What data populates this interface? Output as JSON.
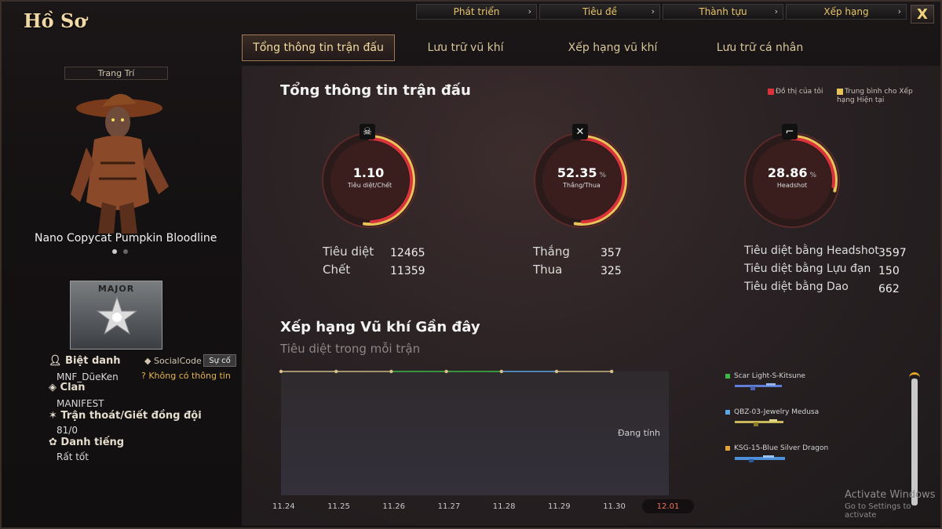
{
  "window": {
    "title": "Hồ Sơ",
    "close_label": "X"
  },
  "top_menu": [
    {
      "label": "Phát triển"
    },
    {
      "label": "Tiêu đề"
    },
    {
      "label": "Thành tựu"
    },
    {
      "label": "Xếp hạng"
    }
  ],
  "tabs": [
    {
      "label": "Tổng thông tin trận đấu",
      "active": true
    },
    {
      "label": "Lưu trữ vũ khí"
    },
    {
      "label": "Xếp hạng vũ khí"
    },
    {
      "label": "Lưu trữ cá nhân"
    }
  ],
  "left": {
    "decoration_label": "Trang Trí",
    "character_name": "Nano Copycat Pumpkin Bloodline",
    "rank": "MAJOR",
    "nickname_label": "Biệt danh",
    "nickname_value": "MNF_DũeKen",
    "social_code_label": "SocialCode",
    "social_code_button": "Sự cố",
    "social_code_info": "Không có thông tin",
    "clan_label": "Clan",
    "clan_value": "MANIFEST",
    "desert_label": "Trận thoát/Giết đồng đội",
    "desert_value": "81/0",
    "reputation_label": "Danh tiếng",
    "reputation_value": "Rất tốt"
  },
  "overview": {
    "title": "Tổng thông tin trận đấu",
    "legend_mine": "Đồ thị của tôi",
    "legend_avg": "Trung bình cho Xếp hạng Hiện tại",
    "colors": {
      "mine": "#d8333a",
      "avg": "#e7c35a"
    },
    "gauges": [
      {
        "value": "1.10",
        "unit": "",
        "label": "Tiêu diệt/Chết",
        "icon": "skull-icon",
        "fill": 0.52
      },
      {
        "value": "52.35",
        "unit": "%",
        "label": "Thắng/Thua",
        "icon": "crossed-rifles-icon",
        "fill": 0.5235
      },
      {
        "value": "28.86",
        "unit": "%",
        "label": "Headshot",
        "icon": "rifle-icon",
        "fill": 0.2886
      }
    ],
    "stats_kd": [
      {
        "label": "Tiêu diệt",
        "value": "12465"
      },
      {
        "label": "Chết",
        "value": "11359"
      }
    ],
    "stats_wl": [
      {
        "label": "Thắng",
        "value": "357"
      },
      {
        "label": "Thua",
        "value": "325"
      }
    ],
    "stats_hs": [
      {
        "label": "Tiêu diệt bằng Headshot",
        "value": "3597"
      },
      {
        "label": "Tiêu diệt bằng Lựu đạn",
        "value": "150"
      },
      {
        "label": "Tiêu diệt bằng Dao",
        "value": "662"
      }
    ]
  },
  "weapons": {
    "title": "Xếp hạng Vũ khí Gần đây",
    "subtitle": "Tiêu diệt trong mỗi trận",
    "pending": "Đang tính",
    "selected_date": "12.01",
    "list": [
      {
        "name": "Scar Light-S-Kitsune",
        "color": "#3fb84a"
      },
      {
        "name": "QBZ-03-Jewelry Medusa",
        "color": "#5aa7e6"
      },
      {
        "name": "KSG-15-Blue Silver Dragon",
        "color": "#e0a23a"
      }
    ]
  },
  "chart_data": {
    "type": "line",
    "title": "Xếp hạng Vũ khí Gần đây",
    "subtitle": "Tiêu diệt trong mỗi trận",
    "x": [
      "11.24",
      "11.25",
      "11.26",
      "11.27",
      "11.28",
      "11.29",
      "11.30",
      "12.01"
    ],
    "series": [
      {
        "name": "Scar Light-S-Kitsune",
        "color": "#3fb84a"
      },
      {
        "name": "QBZ-03-Jewelry Medusa",
        "color": "#5aa7e6"
      },
      {
        "name": "KSG-15-Blue Silver Dragon",
        "color": "#e0a23a"
      }
    ],
    "annotations": [
      "Đang tính"
    ],
    "grid": false
  },
  "os_overlay": {
    "line1": "Activate Windows",
    "line2": "Go to Settings to activate"
  }
}
